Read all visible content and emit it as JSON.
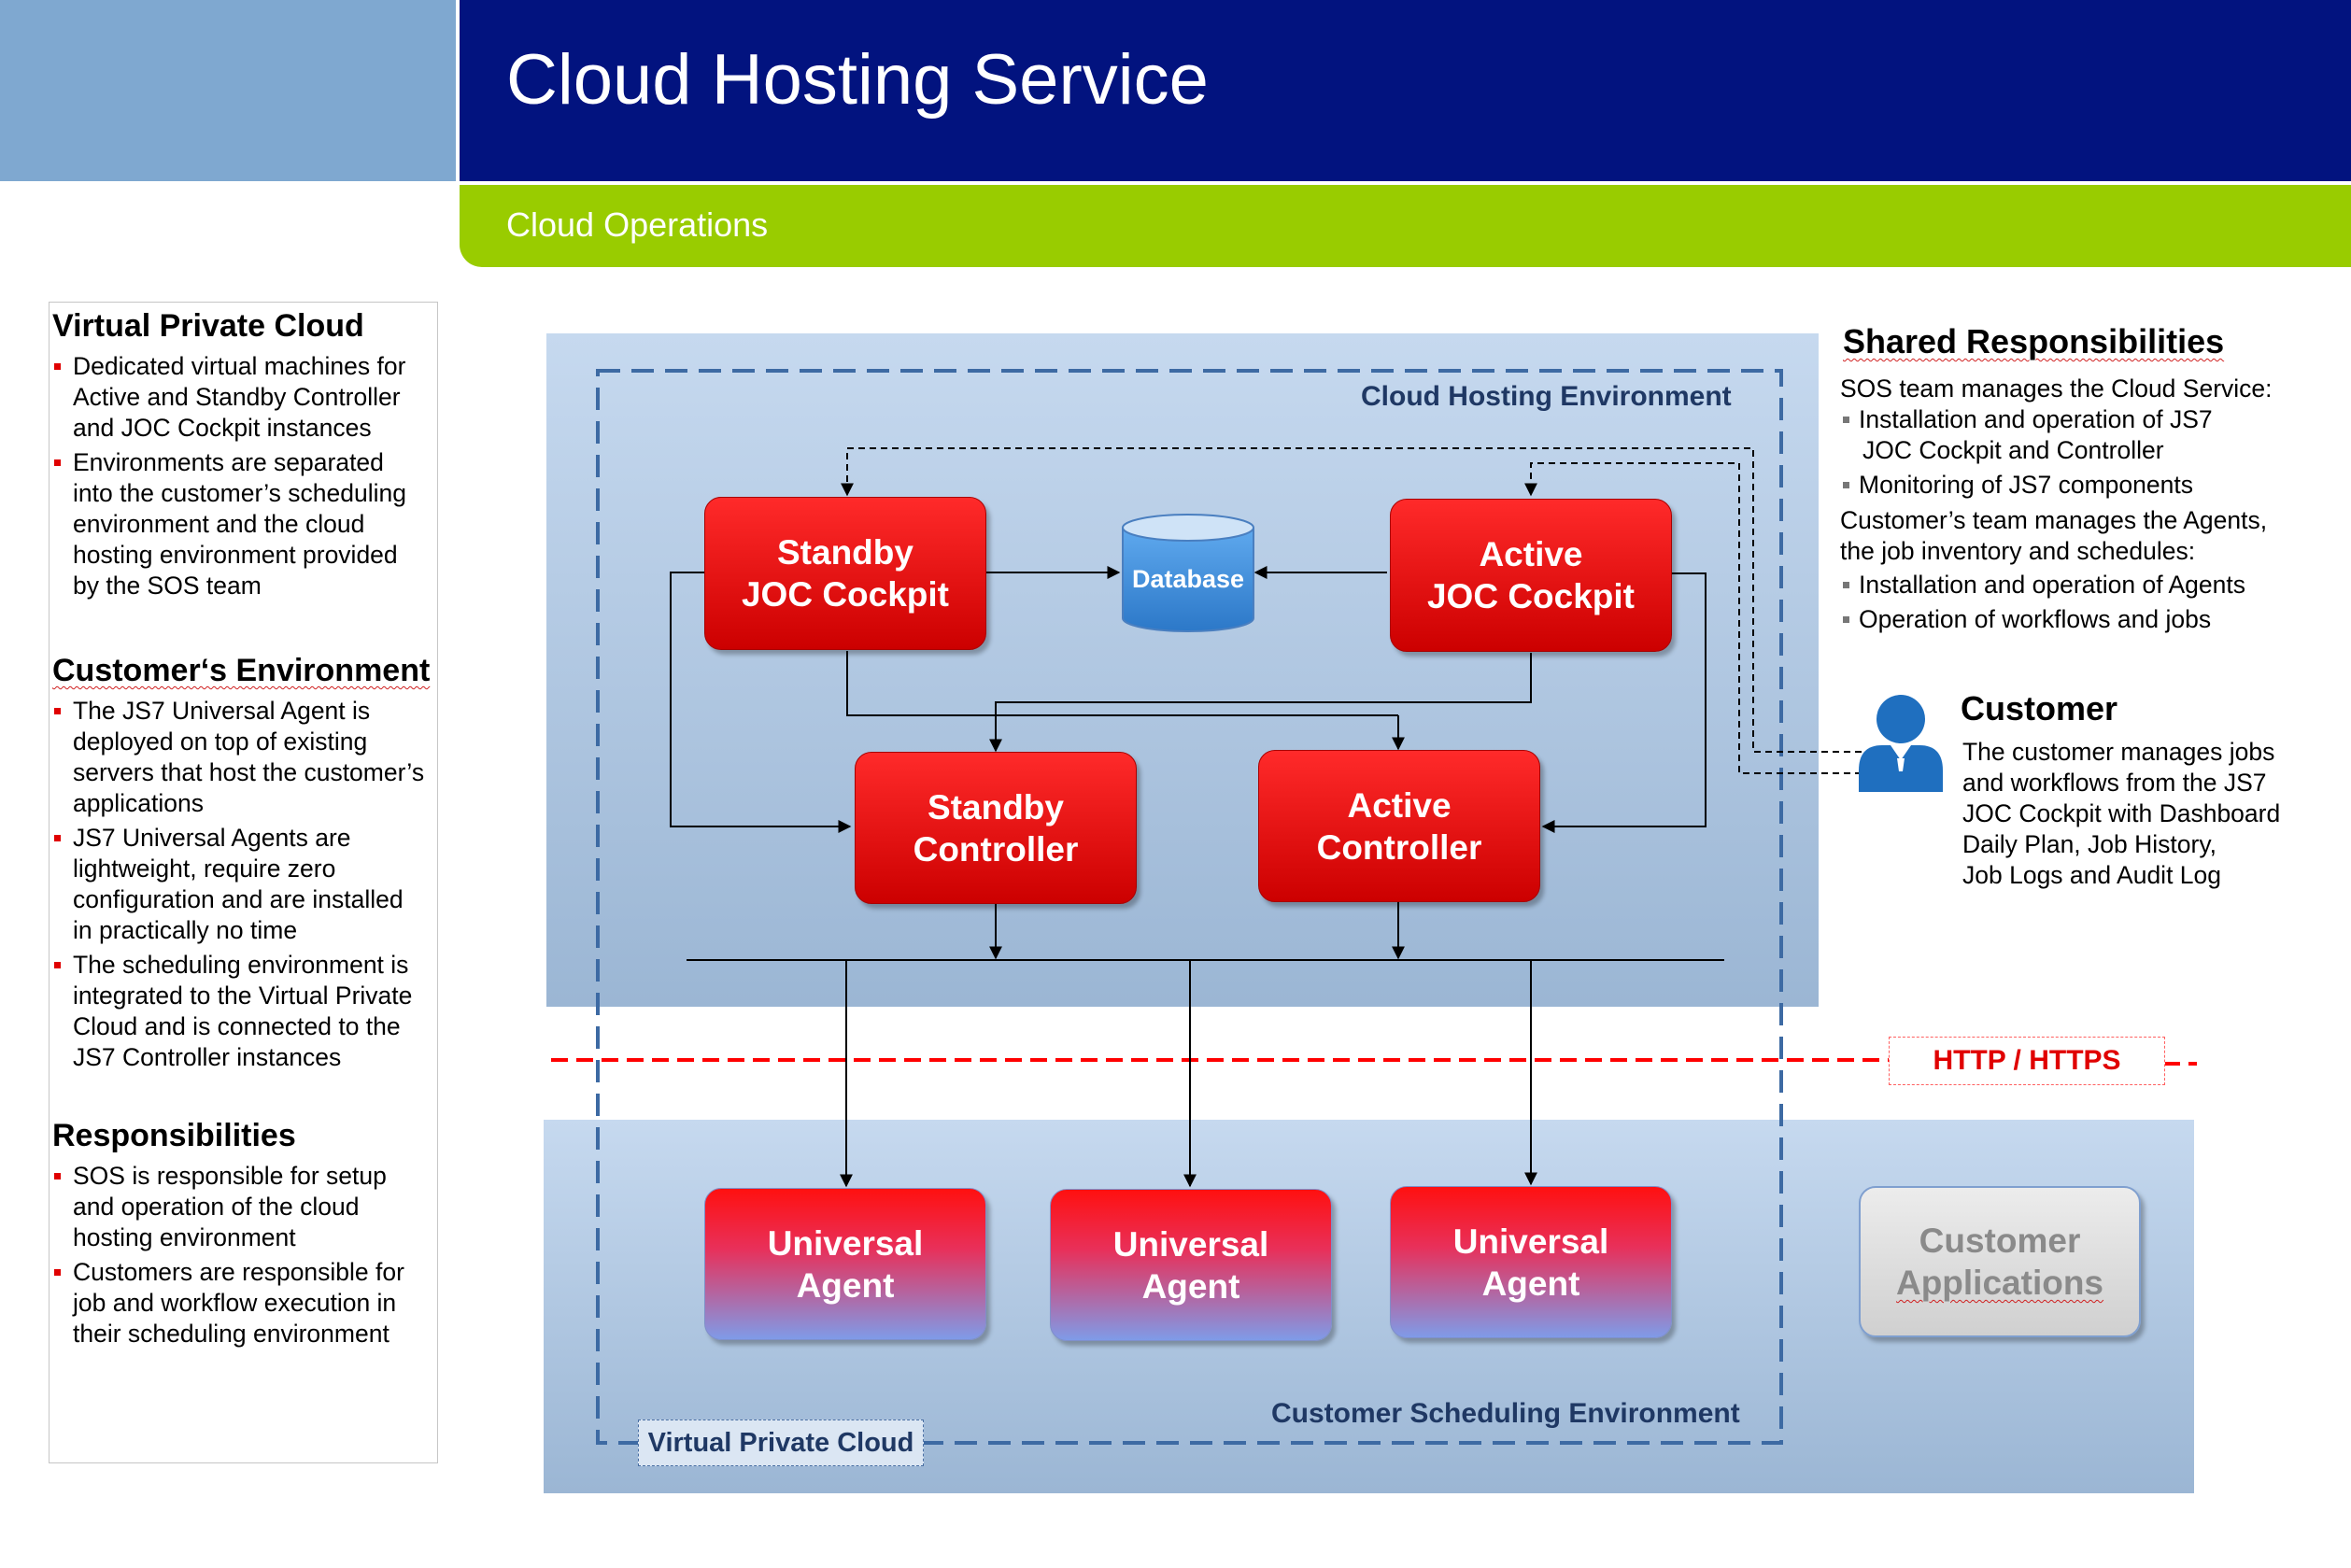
{
  "header": {
    "title": "Cloud Hosting Service",
    "subtitle": "Cloud Operations"
  },
  "left_panel": {
    "sections": [
      {
        "title": "Virtual Private Cloud",
        "bullets": [
          "Dedicated virtual machines for Active and Standby Controller and JOC Cockpit instances",
          "Environments are separated into the customer’s scheduling environment and the cloud hosting environment provided by the SOS team"
        ]
      },
      {
        "title": "Customer‘s Environment",
        "bullets": [
          "The JS7 Universal Agent is deployed on top of existing servers that host the customer’s applications",
          "JS7 Universal Agents are lightweight, require zero configuration and are installed in practically no time",
          "The scheduling environment is integrated to the Virtual Private Cloud and is connected to the JS7 Controller instances"
        ]
      },
      {
        "title": "Responsibilities",
        "bullets": [
          "SOS is responsible for setup and operation of the cloud hosting environment",
          "Customers are responsible for job and workflow execution in their scheduling environment"
        ]
      }
    ]
  },
  "shared": {
    "title": "Shared Responsibilities",
    "sos_intro": "SOS team manages the Cloud Service:",
    "sos_bullets": [
      "Installation and operation of JS7",
      "JOC Cockpit and Controller",
      "Monitoring of JS7 components"
    ],
    "customer_intro_1": "Customer’s team manages the Agents,",
    "customer_intro_2": "the job inventory and schedules:",
    "customer_bullets": [
      "Installation and operation of Agents",
      "Operation of workflows and jobs"
    ]
  },
  "customer": {
    "title": "Customer",
    "lines": [
      "The customer manages jobs",
      "and workflows from the JS7",
      "JOC Cockpit with Dashboard",
      "Daily Plan, Job History,",
      "Job Logs and Audit Log"
    ]
  },
  "diagram": {
    "cloud_env_label": "Cloud Hosting Environment",
    "sched_env_label": "Customer Scheduling Environment",
    "vpc_label": "Virtual Private Cloud",
    "protocol_label": "HTTP / HTTPS",
    "database_label": "Database",
    "standby_joc": [
      "Standby",
      "JOC Cockpit"
    ],
    "active_joc": [
      "Active",
      "JOC Cockpit"
    ],
    "standby_controller": [
      "Standby",
      "Controller"
    ],
    "active_controller": [
      "Active",
      "Controller"
    ],
    "agent": [
      "Universal",
      "Agent"
    ],
    "customer_apps": [
      "Customer",
      "Applications"
    ],
    "colors": {
      "header_blue": "#02137f",
      "header_green": "#99cc00",
      "box_red": "#e60000",
      "protocol_red": "#ff0000",
      "env_label": "#1f3864"
    }
  }
}
